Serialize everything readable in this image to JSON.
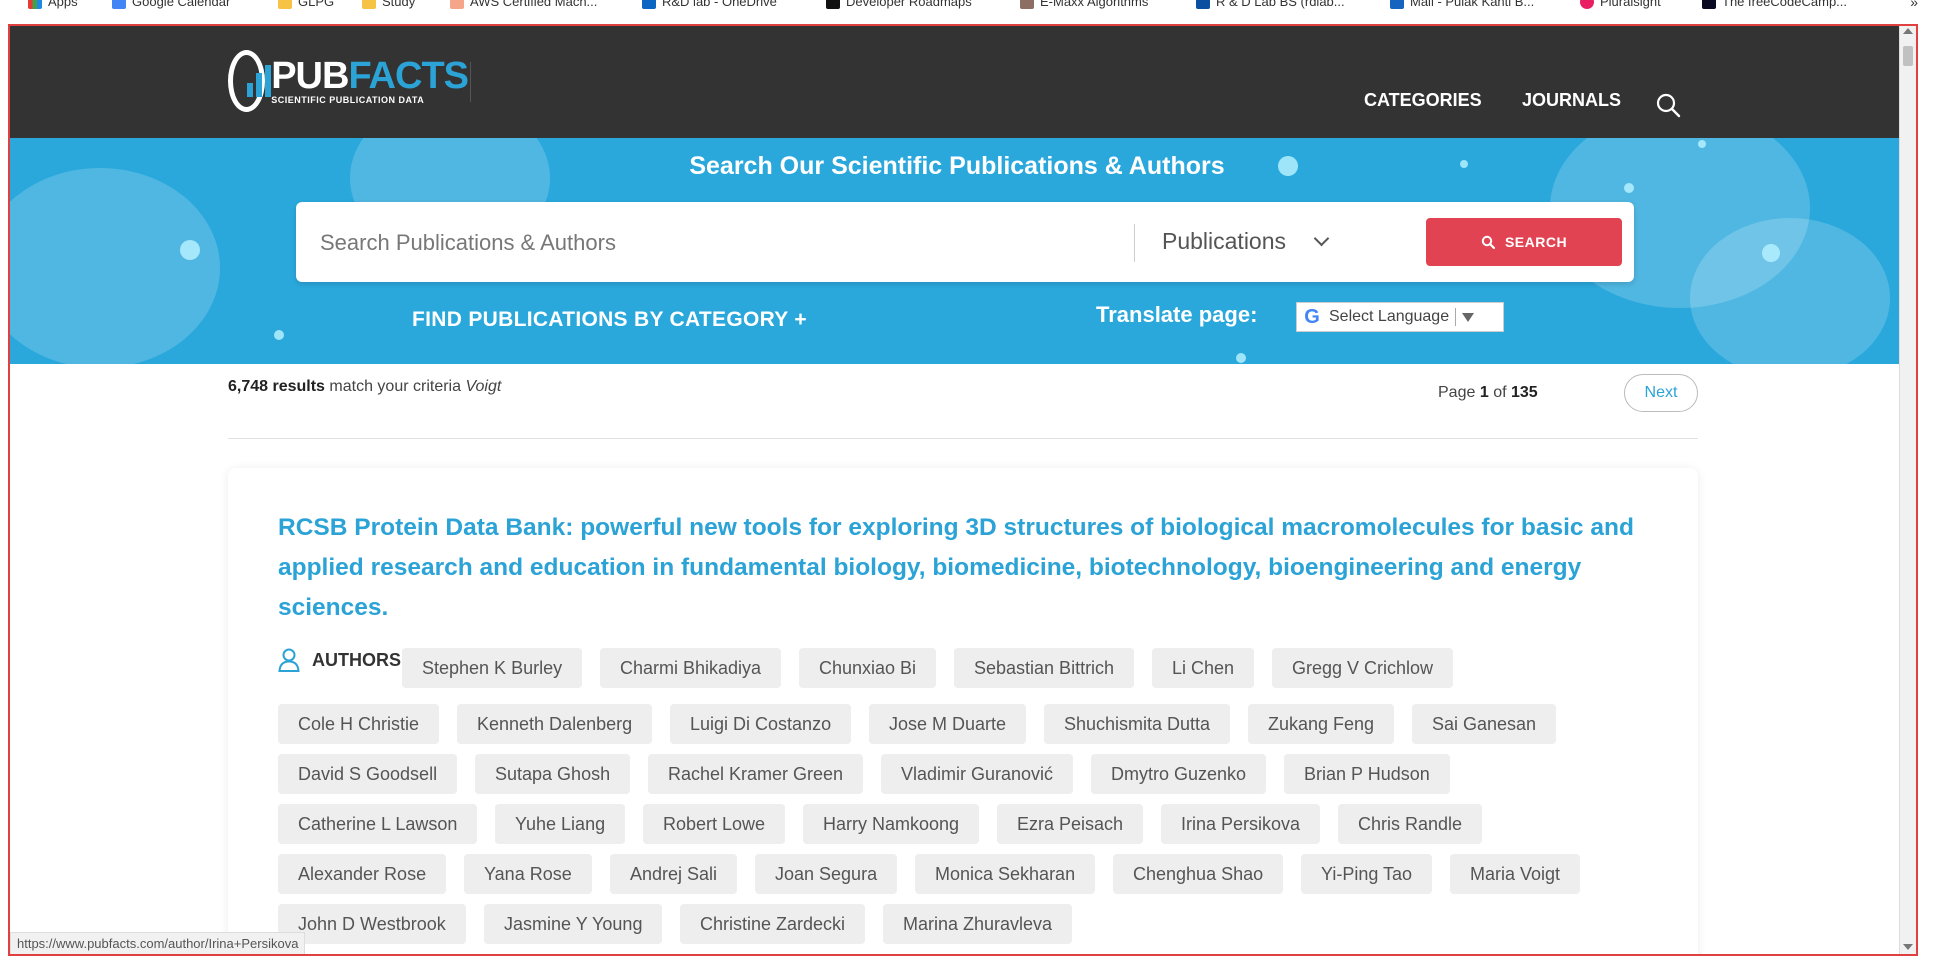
{
  "bookmarks": [
    "Apps",
    "Google Calendar",
    "GLPG",
    "Study",
    "AWS Certified Mach...",
    "R&D lab - OneDrive",
    "Developer Roadmaps",
    "E-Maxx Algorithms",
    "R & D Lab BS (rdlab...",
    "Mail - Pulak Kanti B...",
    "Pluralsight",
    "The freeCodeCamp...",
    "»"
  ],
  "header": {
    "logo_main": "PUB",
    "logo_accent": "FACTS",
    "logo_tagline": "SCIENTIFIC PUBLICATION DATA",
    "nav": [
      "CATEGORIES",
      "JOURNALS"
    ],
    "search_icon": "search-icon"
  },
  "hero": {
    "title": "Search Our Scientific Publications & Authors",
    "search_placeholder": "Search Publications & Authors",
    "search_type": "Publications",
    "search_button": "SEARCH",
    "find_category": "FIND PUBLICATIONS BY CATEGORY +",
    "translate_label": "Translate page:",
    "language_select": "Select Language"
  },
  "results": {
    "count": "6,748 results",
    "text": "match your criteria",
    "query": "Voigt",
    "page_prefix": "Page",
    "page_current": "1",
    "page_of": "of",
    "page_total": "135",
    "next": "Next"
  },
  "article": {
    "title": "RCSB Protein Data Bank: powerful new tools for exploring 3D structures of biological macromolecules for basic and applied research and education in fundamental biology, biomedicine, biotechnology, bioengineering and energy sciences.",
    "authors_label": "AUTHORS:",
    "authors": [
      "Stephen K Burley",
      "Charmi Bhikadiya",
      "Chunxiao Bi",
      "Sebastian Bittrich",
      "Li Chen",
      "Gregg V Crichlow",
      "Cole H Christie",
      "Kenneth Dalenberg",
      "Luigi Di Costanzo",
      "Jose M Duarte",
      "Shuchismita Dutta",
      "Zukang Feng",
      "Sai Ganesan",
      "David S Goodsell",
      "Sutapa Ghosh",
      "Rachel Kramer Green",
      "Vladimir Guranović",
      "Dmytro Guzenko",
      "Brian P Hudson",
      "Catherine L Lawson",
      "Yuhe Liang",
      "Robert Lowe",
      "Harry Namkoong",
      "Ezra Peisach",
      "Irina Persikova",
      "Chris Randle",
      "Alexander Rose",
      "Yana Rose",
      "Andrej Sali",
      "Joan Segura",
      "Monica Sekharan",
      "Chenghua Shao",
      "Yi-Ping Tao",
      "Maria Voigt",
      "John D Westbrook",
      "Jasmine Y Young",
      "Christine Zardecki",
      "Marina Zhuravleva"
    ]
  },
  "status_bar": {
    "url": "https://www.pubfacts.com/author/Irina+Persikova"
  },
  "colors": {
    "header_bg": "#333333",
    "accent": "#2ba3d6",
    "hero_bg": "#2aa8dc",
    "search_btn": "#e24352"
  }
}
